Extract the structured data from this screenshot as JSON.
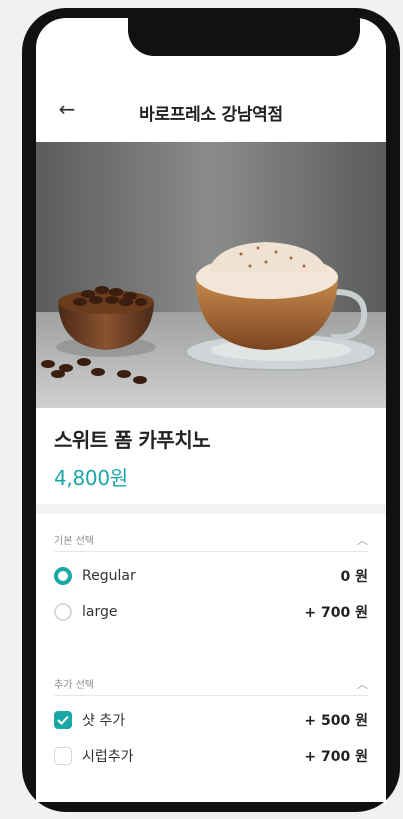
{
  "header": {
    "title": "바로프레소 강남역점",
    "back_icon": "arrow-left-icon"
  },
  "product": {
    "name": "스위트 폼 카푸치노",
    "price": "4,800원"
  },
  "basic_section": {
    "label": "기본 선택",
    "options": [
      {
        "label": "Regular",
        "price": "0 원",
        "selected": true
      },
      {
        "label": "large",
        "price": "+ 700 원",
        "selected": false
      }
    ]
  },
  "extra_section": {
    "label": "추가 선택",
    "options": [
      {
        "label": "샷 추가",
        "price": "+ 500 원",
        "checked": true
      },
      {
        "label": "시럽추가",
        "price": "+ 700 원",
        "checked": false
      }
    ]
  },
  "colors": {
    "accent": "#1aa8a6"
  }
}
